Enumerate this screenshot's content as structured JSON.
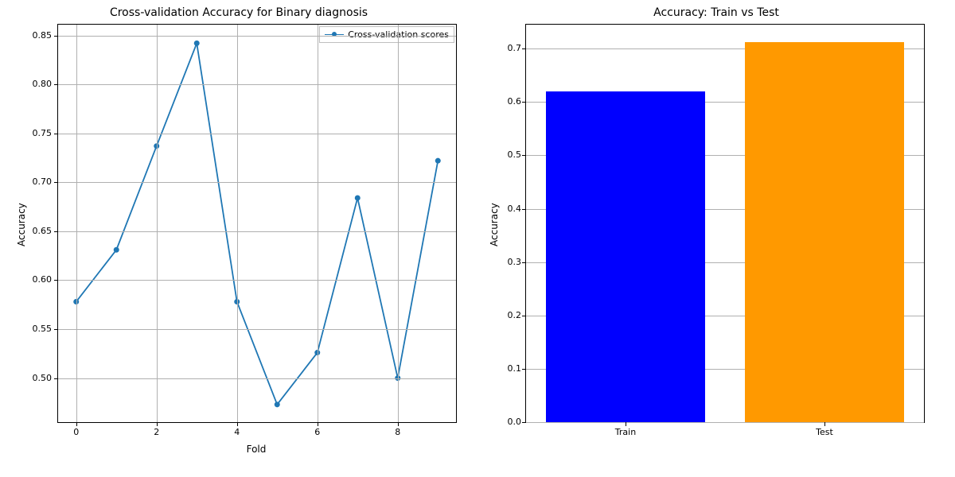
{
  "chart_data": [
    {
      "type": "line",
      "title": "Cross-validation Accuracy for Binary diagnosis",
      "xlabel": "Fold",
      "ylabel": "Accuracy",
      "legend": [
        "Cross-validation scores"
      ],
      "x": [
        0,
        1,
        2,
        3,
        4,
        5,
        6,
        7,
        8,
        9
      ],
      "values": [
        0.578,
        0.631,
        0.737,
        0.842,
        0.578,
        0.473,
        0.526,
        0.684,
        0.5,
        0.722
      ],
      "xlim": [
        -0.45,
        9.45
      ],
      "ylim": [
        0.455,
        0.861
      ],
      "xticks": [
        0,
        2,
        4,
        6,
        8
      ],
      "yticks": [
        0.5,
        0.55,
        0.6,
        0.65,
        0.7,
        0.75,
        0.8,
        0.85
      ],
      "grid": true,
      "color": "#1f77b4"
    },
    {
      "type": "bar",
      "title": "Accuracy: Train vs Test",
      "xlabel": "",
      "ylabel": "Accuracy",
      "categories": [
        "Train",
        "Test"
      ],
      "values": [
        0.62,
        0.712
      ],
      "colors": [
        "#0000ff",
        "#ff9900"
      ],
      "ylim": [
        0.0,
        0.745
      ],
      "yticks": [
        0.0,
        0.1,
        0.2,
        0.3,
        0.4,
        0.5,
        0.6,
        0.7
      ],
      "grid": true
    }
  ]
}
